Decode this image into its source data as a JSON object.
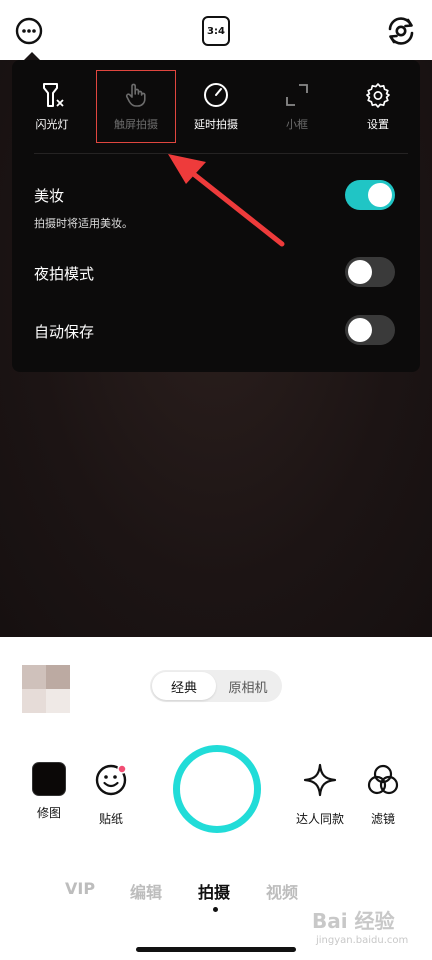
{
  "topbar": {
    "ratio_label": "3:4"
  },
  "panel": {
    "tools": [
      {
        "label": "闪光灯",
        "icon": "flash-off-icon"
      },
      {
        "label": "触屏拍摄",
        "icon": "touch-hand-icon"
      },
      {
        "label": "延时拍摄",
        "icon": "timer-icon"
      },
      {
        "label": "小框",
        "icon": "small-frame-icon"
      },
      {
        "label": "设置",
        "icon": "gear-icon"
      }
    ],
    "settings": [
      {
        "title": "美妆",
        "subtitle": "拍摄时将适用美妆。",
        "enabled": true
      },
      {
        "title": "夜拍模式",
        "enabled": false
      },
      {
        "title": "自动保存",
        "enabled": false
      }
    ]
  },
  "bottom": {
    "mode_toggle": {
      "active": "经典",
      "inactive": "原相机"
    },
    "left_buttons": [
      {
        "label": "修图",
        "icon": "photo-thumbnail-icon"
      },
      {
        "label": "贴纸",
        "icon": "sticker-smile-icon"
      }
    ],
    "right_buttons": [
      {
        "label": "达人同款",
        "icon": "sparkle-icon"
      },
      {
        "label": "滤镜",
        "icon": "filter-circles-icon"
      }
    ],
    "tabs": [
      "VIP",
      "编辑",
      "拍摄",
      "视频"
    ],
    "active_tab": "拍摄"
  },
  "watermark": {
    "main": "Bai 经验",
    "sub": "jingyan.baidu.com"
  },
  "colors": {
    "accent": "#21dcd8",
    "toggle_on": "#20c5c5",
    "highlight_red": "#e0463f",
    "panel_bg": "#0c0b0b"
  }
}
